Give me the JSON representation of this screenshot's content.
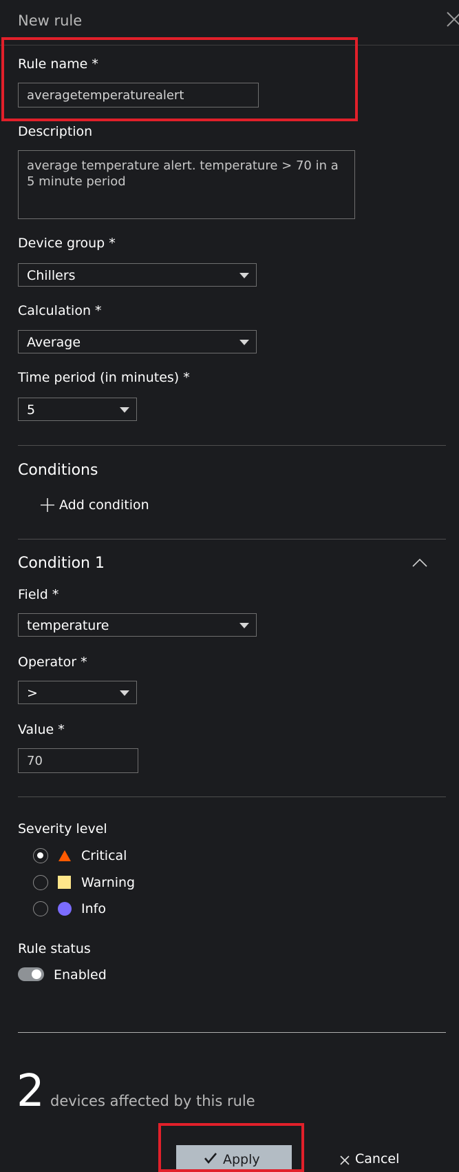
{
  "header": {
    "title": "New rule"
  },
  "form": {
    "rule_name_label": "Rule name *",
    "rule_name_value": "averagetemperaturealert",
    "description_label": "Description",
    "description_value": "average temperature alert. temperature > 70 in a 5 minute period",
    "device_group_label": "Device group *",
    "device_group_value": "Chillers",
    "calculation_label": "Calculation *",
    "calculation_value": "Average",
    "time_period_label": "Time period (in minutes) *",
    "time_period_value": "5"
  },
  "conditions": {
    "title": "Conditions",
    "add_label": "Add condition",
    "items": [
      {
        "title": "Condition 1",
        "field_label": "Field *",
        "field_value": "temperature",
        "operator_label": "Operator *",
        "operator_value": ">",
        "value_label": "Value *",
        "value_value": "70"
      }
    ]
  },
  "severity": {
    "label": "Severity level",
    "options": [
      {
        "label": "Critical",
        "color": "#ff5a00",
        "selected": true
      },
      {
        "label": "Warning",
        "color": "#ffe68a",
        "selected": false
      },
      {
        "label": "Info",
        "color": "#7b6cff",
        "selected": false
      }
    ]
  },
  "status": {
    "label": "Rule status",
    "toggle_label": "Enabled",
    "enabled": true
  },
  "summary": {
    "count": "2",
    "text": "devices affected by this rule"
  },
  "footer": {
    "apply_label": "Apply",
    "cancel_label": "Cancel"
  },
  "colors": {
    "background": "#1b1c1f",
    "highlight": "#e1202a",
    "apply_bg": "#b3bcc4"
  }
}
